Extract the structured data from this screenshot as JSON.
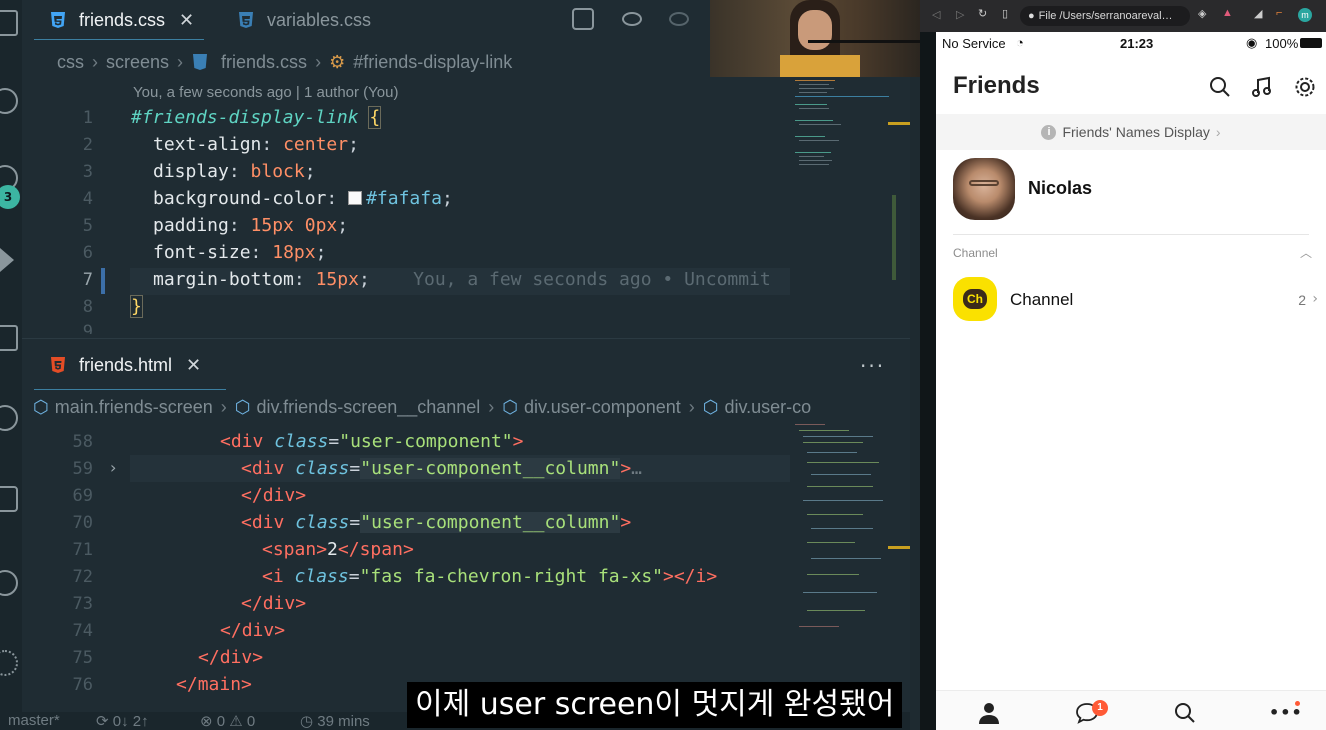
{
  "editor": {
    "tabs": [
      {
        "label": "friends.css",
        "active": true
      },
      {
        "label": "variables.css",
        "active": false
      }
    ],
    "css_breadcrumb": [
      "css",
      "screens",
      "friends.css",
      "#friends-display-link"
    ],
    "blame_header": "You, a few seconds ago | 1 author (You)",
    "css_lines": [
      {
        "n": "1"
      },
      {
        "n": "2"
      },
      {
        "n": "3"
      },
      {
        "n": "4"
      },
      {
        "n": "5"
      },
      {
        "n": "6"
      },
      {
        "n": "7"
      },
      {
        "n": "8"
      },
      {
        "n": "9"
      }
    ],
    "css": {
      "selector": "#friends-display-link",
      "open": "{",
      "close": "}",
      "p1": "text-align",
      "v1": "center",
      "p2": "display",
      "v2": "block",
      "p3": "background-color",
      "v3": "#fafafa",
      "p4": "padding",
      "v4": "15px 0px",
      "p5": "font-size",
      "v5": "18px",
      "p6": "margin-bottom",
      "v6": "15px",
      "inline_blame": "You, a few seconds ago • Uncommit"
    },
    "html_tab": "friends.html",
    "html_breadcrumb": [
      "main.friends-screen",
      "div.friends-screen__channel",
      "div.user-component",
      "div.user-co"
    ],
    "html_line_numbers": [
      "58",
      "59",
      "69",
      "70",
      "71",
      "72",
      "73",
      "74",
      "75",
      "76"
    ],
    "html": {
      "l58_attr_val": "\"user-component\"",
      "l59_attr_val": "\"user-component__column\"",
      "l70_attr_val": "\"user-component__column\"",
      "l71_text": "2",
      "l72_attr_val": "\"fas fa-chevron-right fa-xs\"",
      "div": "div",
      "span": "span",
      "i": "i",
      "main": "main",
      "class": "class",
      "ellipsis": "…"
    },
    "activity_badge": "3",
    "status_bar": {
      "branch": "master*",
      "sync": "0↓ 2↑",
      "problems": "0",
      "warnings": "0",
      "time": "39 mins"
    }
  },
  "subtitle": "이제 user screen이 멋지게 완성됐어",
  "simulator": {
    "url": "File  /Users/serranoareval…"
  },
  "phone": {
    "carrier": "No Service",
    "time": "21:23",
    "battery": "100%",
    "title": "Friends",
    "banner": "Friends' Names Display",
    "banner_chevron": "›",
    "user_name": "Nicolas",
    "section_label": "Channel",
    "channel_logo_text": "Ch",
    "channel_name": "Channel",
    "channel_count": "2",
    "chat_badge": "1",
    "colors": {
      "channel_yellow": "#fae100",
      "badge": "#ff5a36"
    }
  }
}
